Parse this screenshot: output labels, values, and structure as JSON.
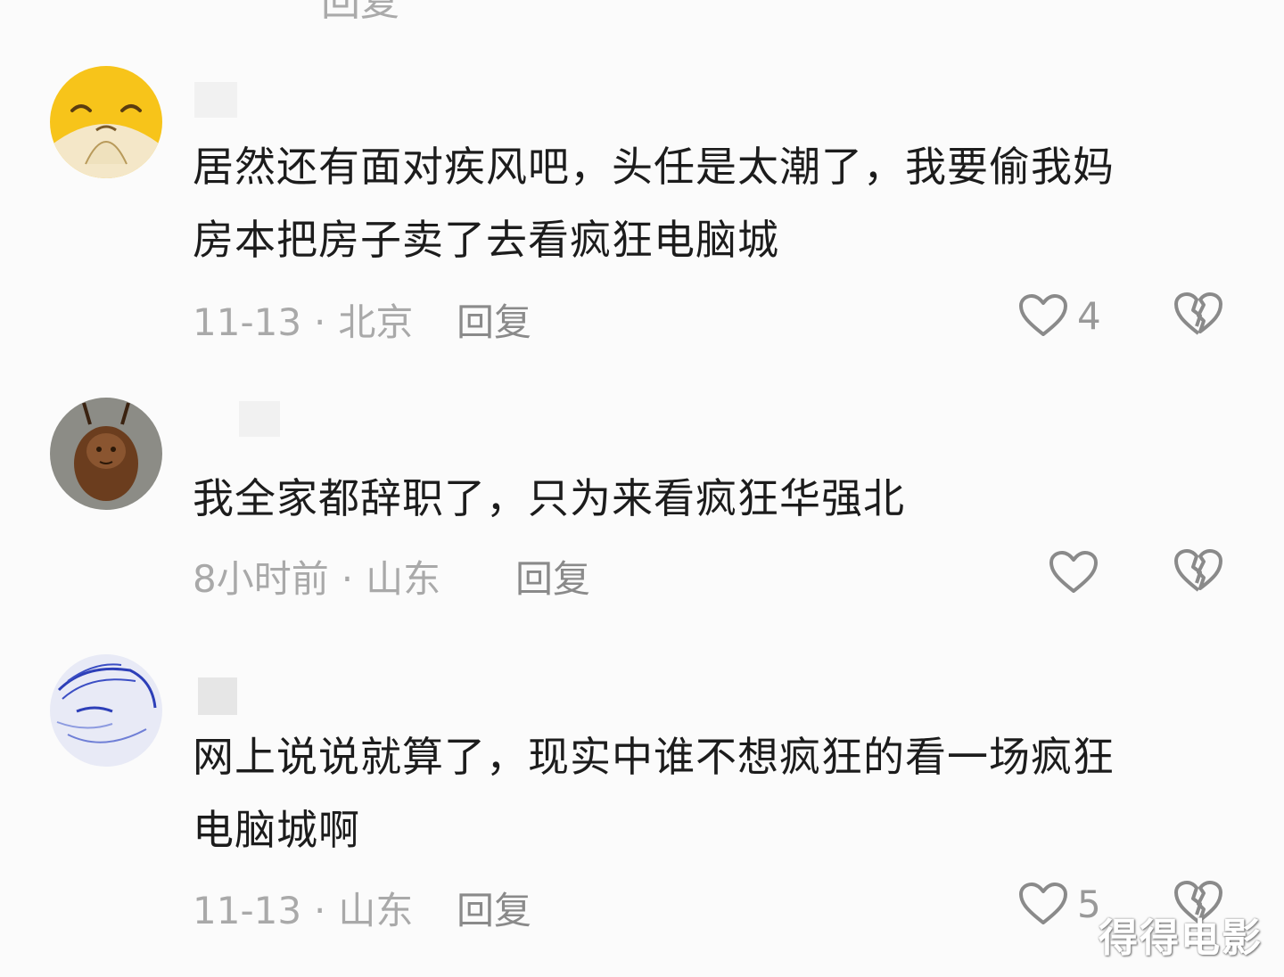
{
  "clipped_previous": {
    "meta_text": "回复"
  },
  "comments": [
    {
      "text_line1": "居然还有面对疾风吧，头任是太潮了，我要偷我妈",
      "text_line2": "房本把房子卖了去看疯狂电脑城",
      "date": "11-13",
      "dot": "·",
      "location": "北京",
      "reply_label": "回复",
      "like_count": "4"
    },
    {
      "text_line1": "我全家都辞职了，只为来看疯狂华强北",
      "date": "8小时前",
      "dot": "·",
      "location": "山东",
      "reply_label": "回复",
      "like_count": ""
    },
    {
      "text_line1": "网上说说就算了，现实中谁不想疯狂的看一场疯狂",
      "text_line2": "电脑城啊",
      "date": "11-13",
      "dot": "·",
      "location": "山东",
      "reply_label": "回复",
      "like_count": "5"
    }
  ],
  "icons": {
    "like": "heart-outline-icon",
    "dislike": "broken-heart-icon"
  },
  "watermark": "得得电影",
  "colors": {
    "background": "#fbfbfb",
    "text": "#1c1c1c",
    "meta": "#a9a9a9",
    "icon": "#8a8a8a"
  }
}
